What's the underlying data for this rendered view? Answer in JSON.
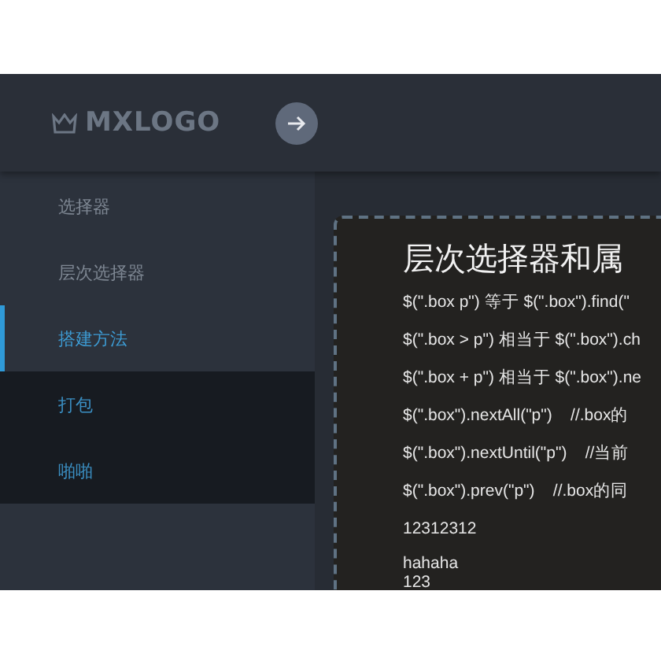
{
  "header": {
    "logo": "MXLOGO"
  },
  "sidebar": {
    "items": [
      {
        "label": "选择器",
        "selected": false
      },
      {
        "label": "层次选择器",
        "selected": false
      },
      {
        "label": "搭建方法",
        "selected": true,
        "children": [
          {
            "label": "打包"
          },
          {
            "label": "啪啪"
          }
        ]
      }
    ]
  },
  "content": {
    "title": "层次选择器和属",
    "lines": [
      "$(\".box p\") 等于 $(\".box\").find(\"",
      "$(\".box > p\") 相当于 $(\".box\").ch",
      "$(\".box + p\") 相当于 $(\".box\").ne",
      "$(\".box\").nextAll(\"p\")    //.box的",
      "$(\".box\").nextUntil(\"p\")    //当前",
      "$(\".box\").prev(\"p\")    //.box的同",
      "12312312"
    ],
    "tail": [
      "hahaha",
      "123"
    ]
  }
}
